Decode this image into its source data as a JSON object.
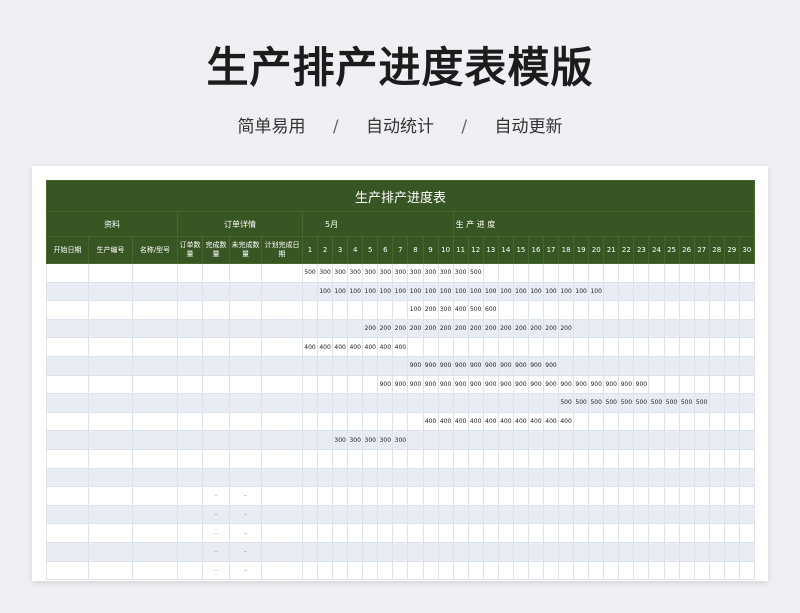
{
  "title": "生产排产进度表模版",
  "subtitle": [
    "简单易用",
    "自动统计",
    "自动更新"
  ],
  "subtitle_sep": "/",
  "sheet": {
    "title": "生产排产进度表",
    "group_material": "资料",
    "group_order": "订单详情",
    "month": "5月",
    "progress_label": "生 产 进 度",
    "columns": [
      "开始日期",
      "生产编号",
      "名称/型号",
      "订单数量",
      "完成数量",
      "未完成数量",
      "计划完成日期"
    ],
    "days": [
      "1",
      "2",
      "3",
      "4",
      "5",
      "6",
      "7",
      "8",
      "9",
      "10",
      "11",
      "12",
      "13",
      "14",
      "15",
      "16",
      "17",
      "18",
      "19",
      "20",
      "21",
      "22",
      "23",
      "24",
      "25",
      "26",
      "27",
      "28",
      "29",
      "30"
    ],
    "rows": [
      {
        "start": 1,
        "vals": [
          "500",
          "300",
          "300",
          "300",
          "300",
          "300",
          "300",
          "300",
          "300",
          "300",
          "300",
          "500"
        ]
      },
      {
        "start": 2,
        "vals": [
          "100",
          "100",
          "100",
          "100",
          "100",
          "100",
          "100",
          "100",
          "100",
          "100",
          "100",
          "100",
          "100",
          "100",
          "100",
          "100",
          "100",
          "100",
          "100"
        ]
      },
      {
        "start": 8,
        "vals": [
          "100",
          "200",
          "300",
          "400",
          "500",
          "600"
        ]
      },
      {
        "start": 5,
        "vals": [
          "200",
          "200",
          "200",
          "200",
          "200",
          "200",
          "200",
          "200",
          "200",
          "200",
          "200",
          "200",
          "200",
          "200"
        ]
      },
      {
        "start": 1,
        "vals": [
          "400",
          "400",
          "400",
          "400",
          "400",
          "400",
          "400"
        ]
      },
      {
        "start": 8,
        "vals": [
          "900",
          "900",
          "900",
          "900",
          "900",
          "900",
          "900",
          "900",
          "900",
          "900"
        ]
      },
      {
        "start": 6,
        "vals": [
          "900",
          "900",
          "900",
          "900",
          "900",
          "900",
          "900",
          "900",
          "900",
          "900",
          "900",
          "900",
          "900",
          "900",
          "900",
          "900",
          "900",
          "900"
        ]
      },
      {
        "start": 18,
        "vals": [
          "500",
          "500",
          "500",
          "500",
          "500",
          "500",
          "500",
          "500",
          "500",
          "500"
        ]
      },
      {
        "start": 9,
        "vals": [
          "400",
          "400",
          "400",
          "400",
          "400",
          "400",
          "400",
          "400",
          "400",
          "400"
        ]
      },
      {
        "start": 3,
        "vals": [
          "300",
          "300",
          "300",
          "300",
          "300"
        ]
      },
      {
        "start": 0,
        "vals": []
      },
      {
        "start": 0,
        "vals": []
      },
      {
        "start": 0,
        "vals": [],
        "dashes": [
          "–",
          "–"
        ]
      },
      {
        "start": 0,
        "vals": [],
        "dashes": [
          "–",
          "–"
        ]
      },
      {
        "start": 0,
        "vals": [],
        "dashes": [
          "–",
          "–"
        ]
      },
      {
        "start": 0,
        "vals": [],
        "dashes": [
          "–",
          "–"
        ]
      },
      {
        "start": 0,
        "vals": [],
        "dashes": [
          "–",
          "–"
        ]
      }
    ]
  },
  "colors": {
    "header": "#375623",
    "stripe": "#e8edf5",
    "background": "#eef0f4"
  }
}
